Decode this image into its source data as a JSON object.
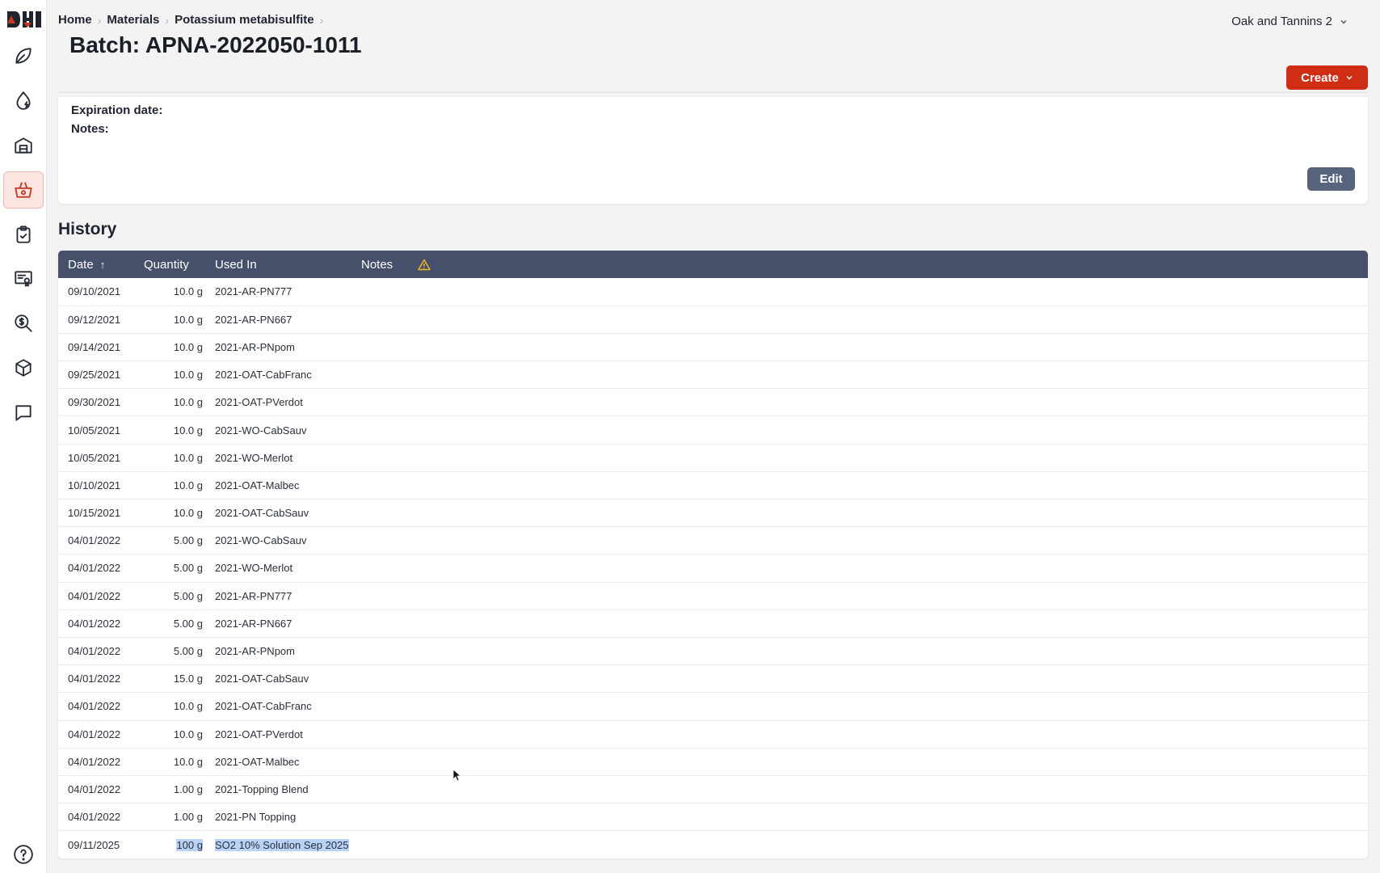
{
  "breadcrumb": {
    "items": [
      "Home",
      "Materials",
      "Potassium metabisulfite"
    ]
  },
  "page": {
    "title": "Batch: APNA-2022050-1011"
  },
  "org": {
    "name": "Oak and Tannins 2"
  },
  "actions": {
    "create_label": "Create",
    "edit_label": "Edit"
  },
  "details": {
    "expiration_label": "Expiration date:",
    "notes_label": "Notes:"
  },
  "history": {
    "title": "History",
    "columns": {
      "date": "Date",
      "quantity": "Quantity",
      "used_in": "Used In",
      "notes": "Notes"
    },
    "rows": [
      {
        "date": "09/10/2021",
        "quantity": "10.0 g",
        "used_in": "2021-AR-PN777"
      },
      {
        "date": "09/12/2021",
        "quantity": "10.0 g",
        "used_in": "2021-AR-PN667"
      },
      {
        "date": "09/14/2021",
        "quantity": "10.0 g",
        "used_in": "2021-AR-PNpom"
      },
      {
        "date": "09/25/2021",
        "quantity": "10.0 g",
        "used_in": "2021-OAT-CabFranc"
      },
      {
        "date": "09/30/2021",
        "quantity": "10.0 g",
        "used_in": "2021-OAT-PVerdot"
      },
      {
        "date": "10/05/2021",
        "quantity": "10.0 g",
        "used_in": "2021-WO-CabSauv"
      },
      {
        "date": "10/05/2021",
        "quantity": "10.0 g",
        "used_in": "2021-WO-Merlot"
      },
      {
        "date": "10/10/2021",
        "quantity": "10.0 g",
        "used_in": "2021-OAT-Malbec"
      },
      {
        "date": "10/15/2021",
        "quantity": "10.0 g",
        "used_in": "2021-OAT-CabSauv"
      },
      {
        "date": "04/01/2022",
        "quantity": "5.00 g",
        "used_in": "2021-WO-CabSauv"
      },
      {
        "date": "04/01/2022",
        "quantity": "5.00 g",
        "used_in": "2021-WO-Merlot"
      },
      {
        "date": "04/01/2022",
        "quantity": "5.00 g",
        "used_in": "2021-AR-PN777"
      },
      {
        "date": "04/01/2022",
        "quantity": "5.00 g",
        "used_in": "2021-AR-PN667"
      },
      {
        "date": "04/01/2022",
        "quantity": "5.00 g",
        "used_in": "2021-AR-PNpom"
      },
      {
        "date": "04/01/2022",
        "quantity": "15.0 g",
        "used_in": "2021-OAT-CabSauv"
      },
      {
        "date": "04/01/2022",
        "quantity": "10.0 g",
        "used_in": "2021-OAT-CabFranc"
      },
      {
        "date": "04/01/2022",
        "quantity": "10.0 g",
        "used_in": "2021-OAT-PVerdot"
      },
      {
        "date": "04/01/2022",
        "quantity": "10.0 g",
        "used_in": "2021-OAT-Malbec"
      },
      {
        "date": "04/01/2022",
        "quantity": "1.00 g",
        "used_in": "2021-Topping Blend"
      },
      {
        "date": "04/01/2022",
        "quantity": "1.00 g",
        "used_in": "2021-PN Topping"
      },
      {
        "date": "09/11/2025",
        "quantity": "100 g",
        "used_in": "SO2 10% Solution Sep 2025",
        "selected": true
      }
    ]
  },
  "colors": {
    "accent": "#cf2e14",
    "table_header": "#46506b",
    "edit_button": "#56637c",
    "selection": "#b8d3f5"
  }
}
